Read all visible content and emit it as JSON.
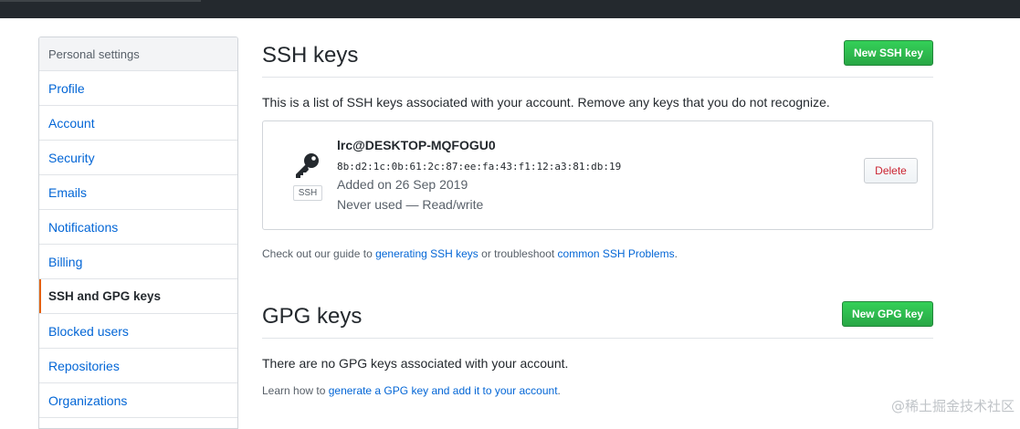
{
  "sidebar": {
    "header": "Personal settings",
    "items": [
      {
        "label": "Profile"
      },
      {
        "label": "Account"
      },
      {
        "label": "Security"
      },
      {
        "label": "Emails"
      },
      {
        "label": "Notifications"
      },
      {
        "label": "Billing"
      },
      {
        "label": "SSH and GPG keys",
        "selected": true
      },
      {
        "label": "Blocked users"
      },
      {
        "label": "Repositories"
      },
      {
        "label": "Organizations"
      }
    ]
  },
  "ssh": {
    "title": "SSH keys",
    "new_button": "New SSH key",
    "description": "This is a list of SSH keys associated with your account. Remove any keys that you do not recognize.",
    "keys": [
      {
        "title": "lrc@DESKTOP-MQFOGU0",
        "fingerprint": "8b:d2:1c:0b:61:2c:87:ee:fa:43:f1:12:a3:81:db:19",
        "added": "Added on 26 Sep 2019",
        "usage": "Never used — Read/write",
        "type_label": "SSH",
        "delete_label": "Delete",
        "icon": "key-icon"
      }
    ],
    "guide": {
      "prefix": "Check out our guide to ",
      "link1": "generating SSH keys",
      "middle": " or troubleshoot ",
      "link2": "common SSH Problems",
      "suffix": "."
    }
  },
  "gpg": {
    "title": "GPG keys",
    "new_button": "New GPG key",
    "empty_message": "There are no GPG keys associated with your account.",
    "guide": {
      "prefix": "Learn how to ",
      "link": "generate a GPG key and add it to your account",
      "suffix": "."
    }
  },
  "watermark": "@稀土掘金技术社区",
  "colors": {
    "primary_button": "#28a745",
    "link": "#0366d6",
    "danger": "#cb2431",
    "selected_indicator": "#e36209",
    "topbar": "#24292e"
  }
}
